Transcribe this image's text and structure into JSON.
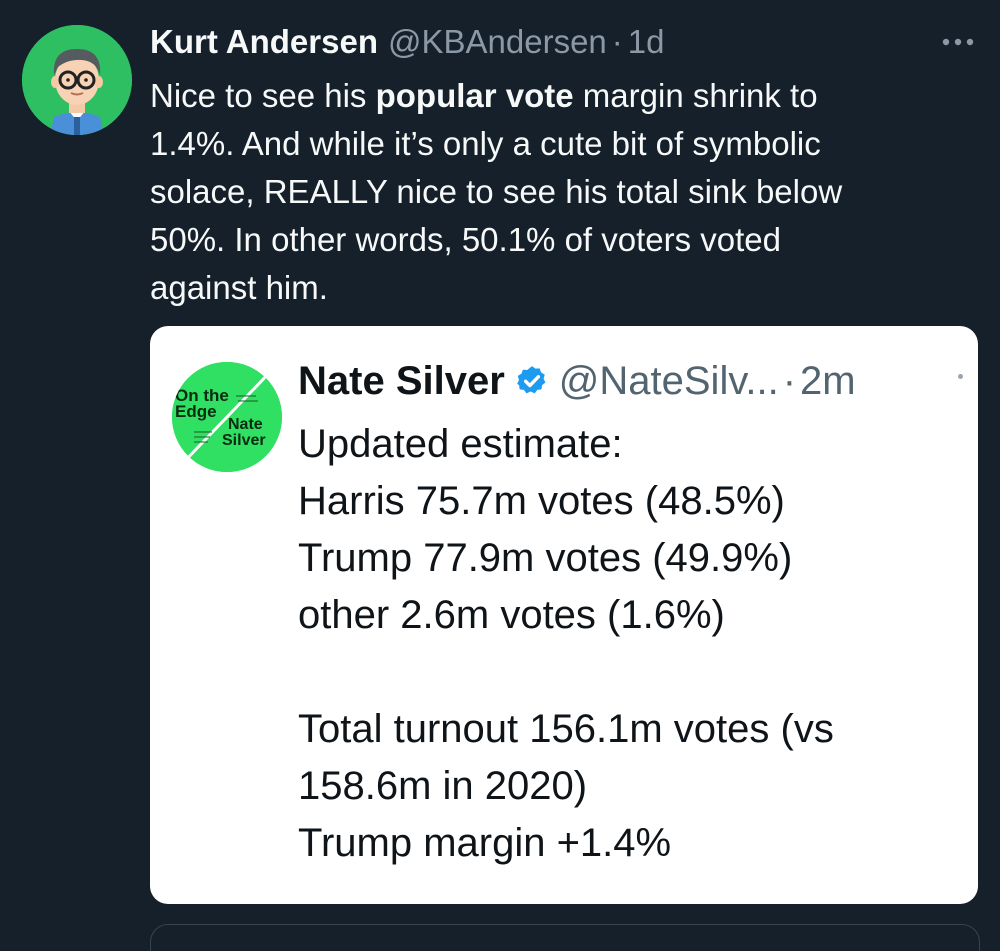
{
  "tweet": {
    "author_name": "Kurt Andersen",
    "author_handle": "@KBAndersen",
    "separator": "·",
    "timestamp": "1d",
    "avatar_icon": "cartoon-avatar-man-glasses",
    "more_icon": "more-options-icon",
    "text_segments": [
      {
        "text": "Nice to see his ",
        "bold": false
      },
      {
        "text": "popular vote",
        "bold": true
      },
      {
        "text": " margin shrink to\n1.4%. And while it’s only a cute bit of symbolic\nsolace, REALLY nice to see his total  sink below\n50%. In other words, 50.1% of voters voted\nagainst him.",
        "bold": false
      }
    ]
  },
  "quoted_tweet": {
    "author_name": "Nate Silver",
    "verified_icon": "verified-badge-icon",
    "author_handle": "@NateSilv...",
    "separator": "·",
    "timestamp": "2m",
    "avatar": {
      "title_line1": "On the",
      "title_line2": "Edge",
      "author_line1": "Nate",
      "author_line2": "Silver"
    },
    "lines": [
      "Updated estimate:",
      "Harris 75.7m votes (48.5%)",
      "Trump 77.9m votes (49.9%)",
      "other 2.6m votes (1.6%)",
      "",
      "Total turnout 156.1m votes (vs",
      "158.6m in 2020)",
      "Trump margin +1.4%"
    ]
  },
  "colors": {
    "background": "#15202b",
    "primary_text": "#f7f9f9",
    "secondary_text": "#8b98a5",
    "card_background": "#ffffff",
    "verified_blue": "#1d9bf0",
    "book_green": "#2fe062"
  }
}
